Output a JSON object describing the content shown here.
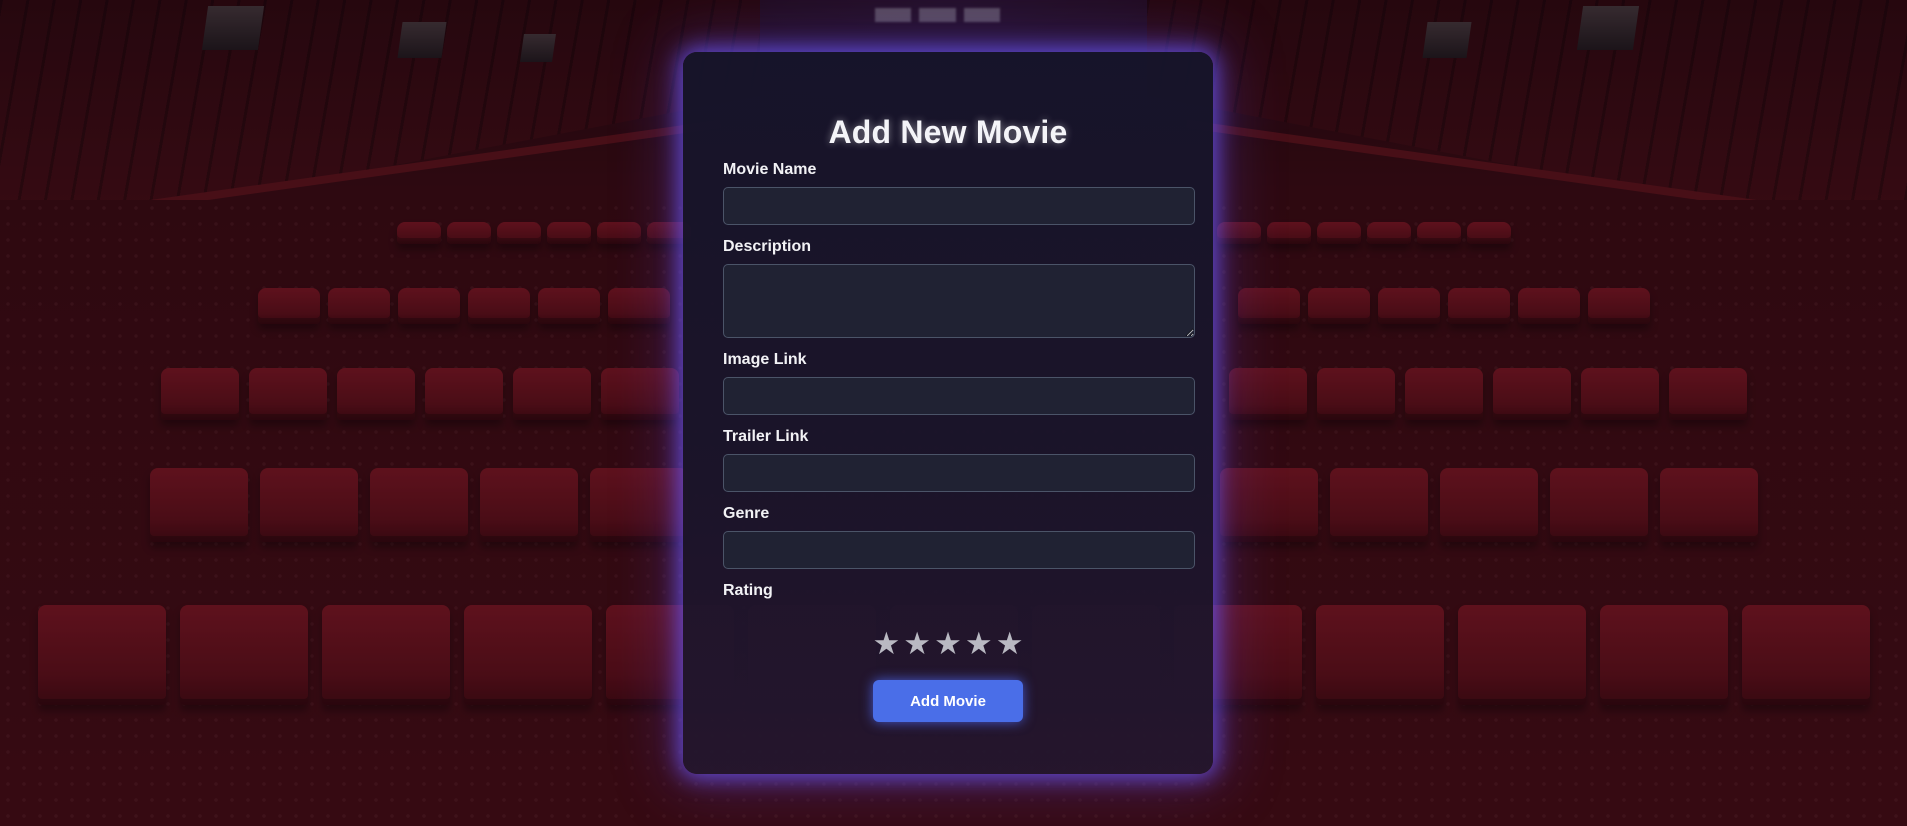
{
  "page": {
    "accent_color": "#4a6ee8",
    "background_theme": "cinema-hall"
  },
  "form": {
    "title": "Add New Movie",
    "fields": [
      {
        "label": "Movie Name",
        "value": "",
        "type": "text"
      },
      {
        "label": "Description",
        "value": "",
        "type": "textarea"
      },
      {
        "label": "Image Link",
        "value": "",
        "type": "text"
      },
      {
        "label": "Trailer Link",
        "value": "",
        "type": "text"
      },
      {
        "label": "Genre",
        "value": "",
        "type": "text"
      }
    ],
    "rating": {
      "label": "Rating",
      "stars": [
        "★",
        "★",
        "★",
        "★",
        "★"
      ],
      "max": 5,
      "selected": 0
    },
    "submit_label": "Add Movie"
  }
}
